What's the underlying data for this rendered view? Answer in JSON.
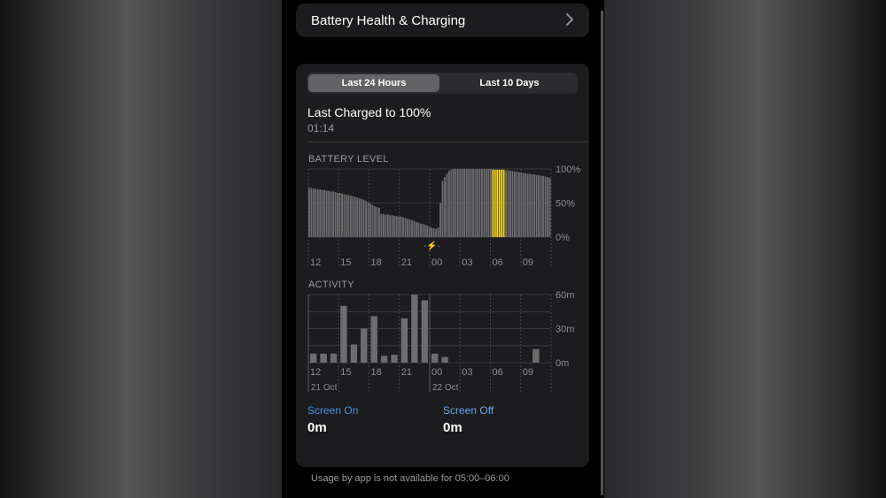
{
  "header_card": {
    "title": "Battery Health & Charging"
  },
  "segmented": {
    "option1": "Last 24 Hours",
    "option2": "Last 10 Days",
    "selected": "Last 24 Hours"
  },
  "last_charged": {
    "title": "Last Charged to 100%",
    "time": "01:14"
  },
  "battery_section_label": "BATTERY LEVEL",
  "activity_section_label": "ACTIVITY",
  "stats": {
    "screen_on_label": "Screen On",
    "screen_on_value": "0m",
    "screen_off_label": "Screen Off",
    "screen_off_value": "0m"
  },
  "footnote": "Usage by app is not available for 05:00–06:00",
  "colors": {
    "accent": "#4a8fe7",
    "highlight": "#f5d31c",
    "bar": "#6d6d70"
  },
  "chart_data": [
    {
      "type": "bar",
      "title": "BATTERY LEVEL",
      "x_tick_labels": [
        "12",
        "15",
        "18",
        "21",
        "00",
        "03",
        "06",
        "09"
      ],
      "y_tick_labels": [
        "100%",
        "50%",
        "0%"
      ],
      "ylim": [
        0,
        100
      ],
      "values": [
        72,
        72,
        71,
        71,
        70,
        70,
        69,
        69,
        68,
        68,
        67,
        67,
        66,
        65,
        65,
        64,
        63,
        62,
        62,
        61,
        60,
        59,
        58,
        57,
        56,
        55,
        53,
        51,
        49,
        47,
        45,
        44,
        43,
        34,
        34,
        33,
        33,
        32,
        32,
        31,
        31,
        30,
        30,
        29,
        28,
        27,
        26,
        25,
        24,
        22,
        21,
        20,
        19,
        18,
        17,
        15,
        14,
        13,
        12,
        14,
        50,
        82,
        88,
        93,
        97,
        99,
        100,
        100,
        100,
        100,
        100,
        100,
        100,
        100,
        100,
        100,
        100,
        100,
        100,
        100,
        100,
        100,
        100,
        100,
        99,
        99,
        99,
        99,
        99,
        99,
        98,
        98,
        97,
        97,
        96,
        96,
        95,
        95,
        94,
        94,
        93,
        93,
        92,
        92,
        91,
        91,
        90,
        90,
        89,
        88,
        87
      ],
      "highlighted_range": [
        84,
        89
      ],
      "charging_marker_label": "⚡"
    },
    {
      "type": "bar",
      "title": "ACTIVITY",
      "x_tick_labels": [
        "12",
        "15",
        "18",
        "21",
        "00",
        "03",
        "06",
        "09"
      ],
      "date_labels": [
        "21 Oct",
        "22 Oct"
      ],
      "y_tick_labels": [
        "60m",
        "30m",
        "0m"
      ],
      "ylim": [
        0,
        60
      ],
      "values": [
        8,
        8,
        8,
        50,
        16,
        30,
        41,
        6,
        7,
        39,
        60,
        55,
        8,
        5,
        0,
        0,
        0,
        0,
        0,
        0,
        0,
        0,
        12
      ]
    }
  ]
}
